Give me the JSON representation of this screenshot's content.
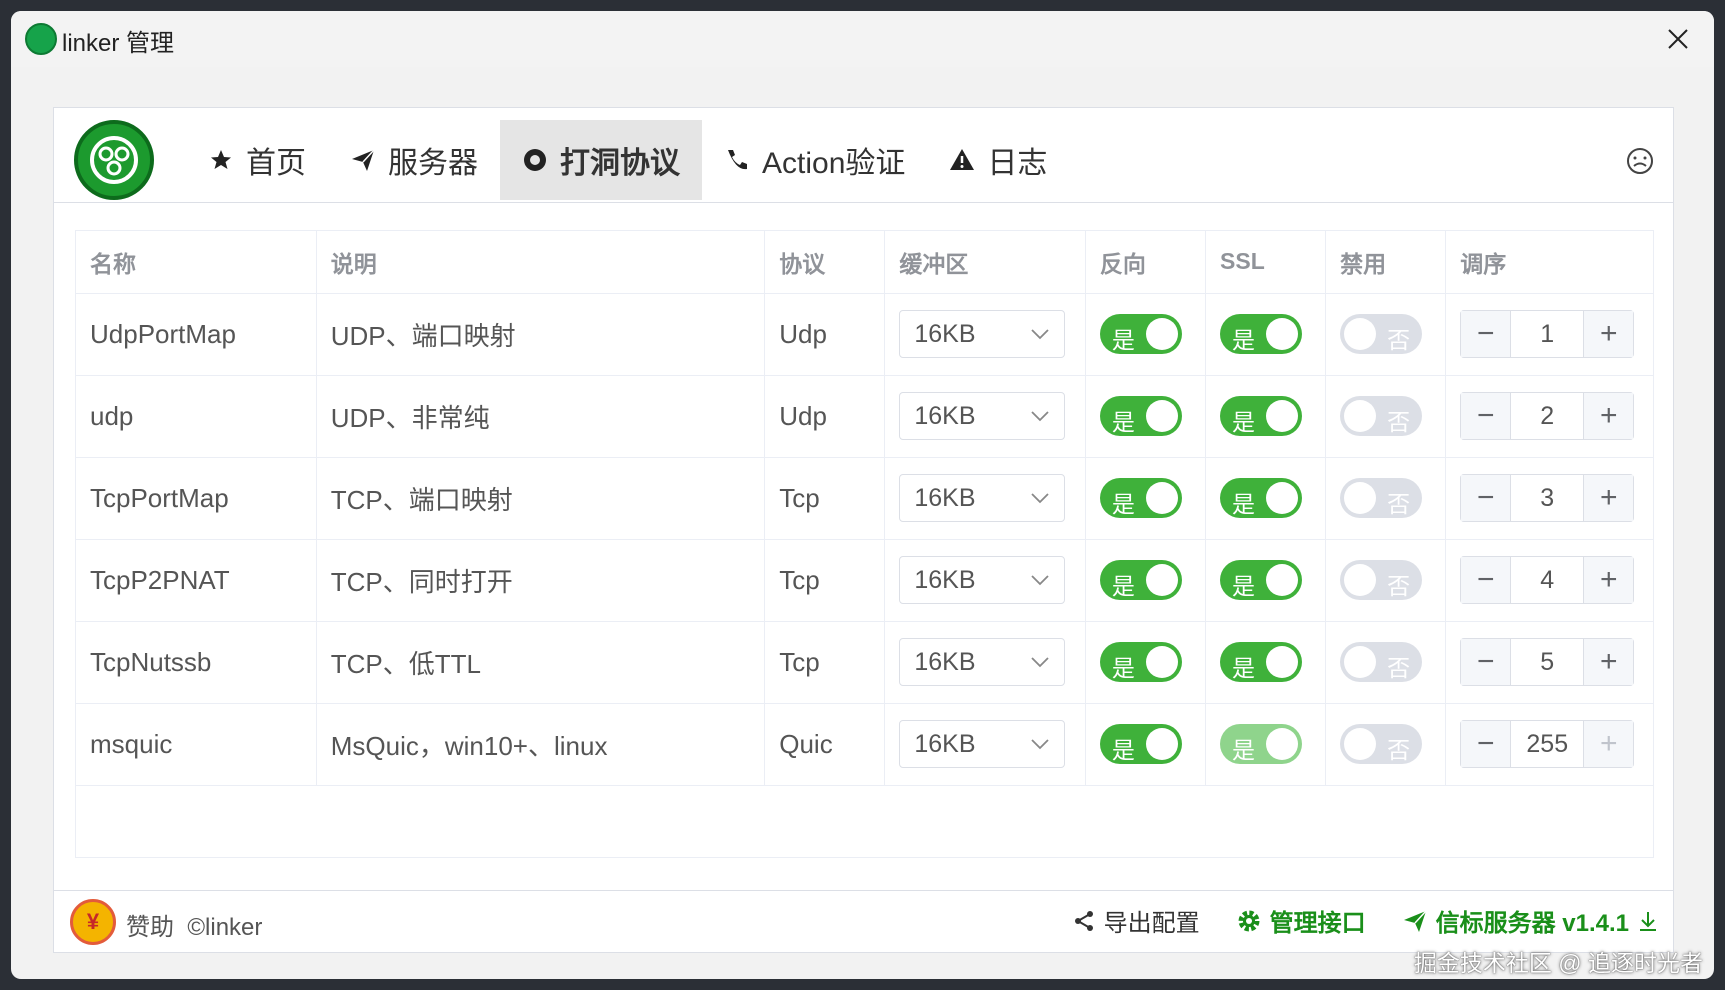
{
  "window": {
    "title": "linker 管理"
  },
  "nav": {
    "items": [
      {
        "label": "首页",
        "icon": "star-icon"
      },
      {
        "label": "服务器",
        "icon": "send-icon"
      },
      {
        "label": "打洞协议",
        "icon": "hole-icon",
        "active": true
      },
      {
        "label": "Action验证",
        "icon": "phone-icon"
      },
      {
        "label": "日志",
        "icon": "warning-icon"
      }
    ]
  },
  "table": {
    "headers": [
      "名称",
      "说明",
      "协议",
      "缓冲区",
      "反向",
      "SSL",
      "禁用",
      "调序"
    ],
    "rows": [
      {
        "name": "UdpPortMap",
        "desc": "UDP、端口映射",
        "protocol": "Udp",
        "buffer": "16KB",
        "reverse": "是",
        "ssl": "是",
        "disabled": "否",
        "order": "1"
      },
      {
        "name": "udp",
        "desc": "UDP、非常纯",
        "protocol": "Udp",
        "buffer": "16KB",
        "reverse": "是",
        "ssl": "是",
        "disabled": "否",
        "order": "2"
      },
      {
        "name": "TcpPortMap",
        "desc": "TCP、端口映射",
        "protocol": "Tcp",
        "buffer": "16KB",
        "reverse": "是",
        "ssl": "是",
        "disabled": "否",
        "order": "3"
      },
      {
        "name": "TcpP2PNAT",
        "desc": "TCP、同时打开",
        "protocol": "Tcp",
        "buffer": "16KB",
        "reverse": "是",
        "ssl": "是",
        "disabled": "否",
        "order": "4"
      },
      {
        "name": "TcpNutssb",
        "desc": "TCP、低TTL",
        "protocol": "Tcp",
        "buffer": "16KB",
        "reverse": "是",
        "ssl": "是",
        "disabled": "否",
        "order": "5"
      },
      {
        "name": "msquic",
        "desc": "MsQuic，win10+、linux",
        "protocol": "Quic",
        "buffer": "16KB",
        "reverse": "是",
        "ssl": "是",
        "disabled": "否",
        "order": "255"
      }
    ]
  },
  "footer": {
    "sponsor": "赞助",
    "copyright": "©linker",
    "export": "导出配置",
    "manage_api": "管理接口",
    "beacon": "信标服务器 v1.4.1"
  },
  "watermark": "掘金技术社区 @ 追逐时光者",
  "colors": {
    "accent_green": "#3fb13a",
    "link_green": "#1a8f1a",
    "disabled_green": "#8fd48c"
  }
}
